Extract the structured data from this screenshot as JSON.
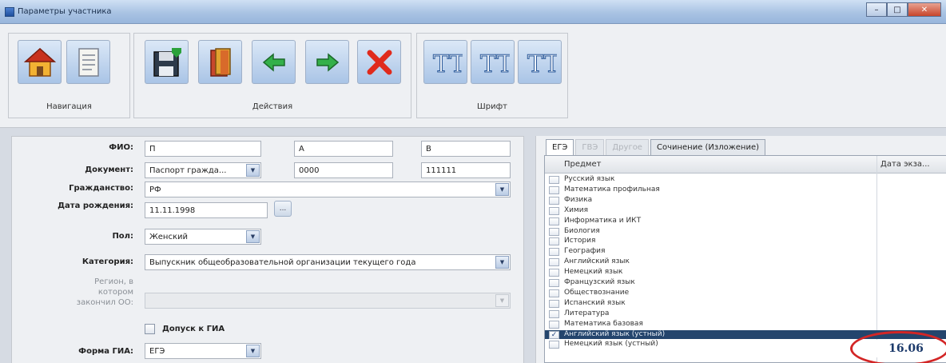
{
  "window": {
    "title": "Параметры участника",
    "min_glyph": "–",
    "max_glyph": "□",
    "close_glyph": "✕"
  },
  "toolbar": {
    "navigation_label": "Навигация",
    "actions_label": "Действия",
    "font_label": "Шрифт",
    "home_icon": "home-icon",
    "document_icon": "document-icon",
    "save_icon": "save-icon",
    "book_icon": "book-icon",
    "back_icon": "arrow-left-icon",
    "forward_icon": "arrow-right-icon",
    "delete_icon": "close-icon",
    "font_glyphs": [
      "TT",
      "TT",
      "TT"
    ]
  },
  "form": {
    "fio_label": "ФИО:",
    "fio_last": "П",
    "fio_first": "А",
    "fio_middle": "В",
    "document_label": "Документ:",
    "document_type": "Паспорт гражда...",
    "document_series": "0000",
    "document_number": "111111",
    "citizenship_label": "Гражданство:",
    "citizenship": "РФ",
    "birth_date_label": "Дата рождения:",
    "birth_date": "11.11.1998",
    "birth_date_button": "...",
    "gender_label": "Пол:",
    "gender": "Женский",
    "category_label": "Категория:",
    "category": "Выпускник общеобразовательной организации текущего года",
    "region_label_line1": "Регион, в",
    "region_label_line2": "котором",
    "region_label_line3": "закончил ОО:",
    "region": "",
    "admission_label": "Допуск к ГИА",
    "admission_checked": false,
    "gia_form_label": "Форма ГИА:",
    "gia_form": "ЕГЭ",
    "combo_arrow": "▼"
  },
  "subjects_panel": {
    "tabs": [
      {
        "label": "ЕГЭ",
        "active": true,
        "disabled": false
      },
      {
        "label": "ГВЭ",
        "active": false,
        "disabled": true
      },
      {
        "label": "Другое",
        "active": false,
        "disabled": true
      },
      {
        "label": "Сочинение (Изложение)",
        "active": false,
        "disabled": false
      }
    ],
    "columns": [
      "Предмет",
      "Дата экза..."
    ],
    "rows": [
      {
        "subject": "Русский язык",
        "checked": false
      },
      {
        "subject": "Математика профильная",
        "checked": false
      },
      {
        "subject": "Физика",
        "checked": false
      },
      {
        "subject": "Химия",
        "checked": false
      },
      {
        "subject": "Информатика и ИКТ",
        "checked": false
      },
      {
        "subject": "Биология",
        "checked": false
      },
      {
        "subject": "История",
        "checked": false
      },
      {
        "subject": "География",
        "checked": false
      },
      {
        "subject": "Английский язык",
        "checked": false
      },
      {
        "subject": "Немецкий язык",
        "checked": false
      },
      {
        "subject": "Французский язык",
        "checked": false
      },
      {
        "subject": "Обществознание",
        "checked": false
      },
      {
        "subject": "Испанский язык",
        "checked": false
      },
      {
        "subject": "Литература",
        "checked": false
      },
      {
        "subject": "Математика базовая",
        "checked": false
      },
      {
        "subject": "Английский язык (устный)",
        "checked": true,
        "selected": true
      },
      {
        "subject": "Немецкий язык (устный)",
        "checked": false
      }
    ],
    "check_glyph": "✓",
    "selected_row_date": "16.06"
  },
  "colors": {
    "selection": "#24456d",
    "annotation_ring": "#d32626"
  }
}
